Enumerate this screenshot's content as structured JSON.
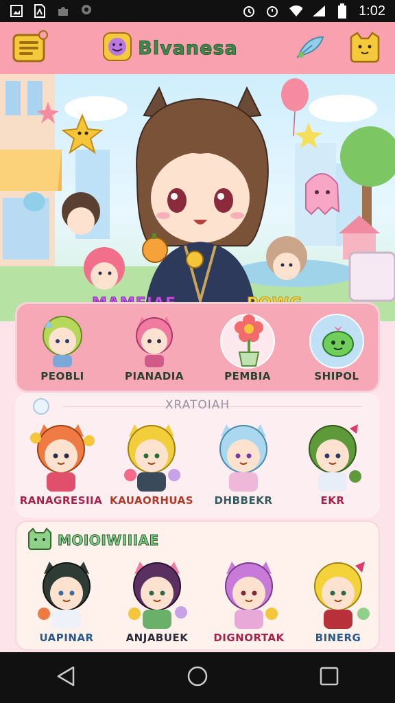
{
  "status_bar": {
    "time": "1:02",
    "icons": [
      "image-icon",
      "file-icon",
      "puzzle-icon",
      "location-icon",
      "alarm-icon",
      "alarm-icon",
      "wifi-icon",
      "signal-icon",
      "battery-icon"
    ]
  },
  "app_bar": {
    "title": "Blvanesa",
    "left_icon": "menu-icon",
    "right_icons": [
      "feather-icon",
      "cat-face-icon"
    ]
  },
  "hero": {
    "tag_left": "MAMEIAE",
    "tag_right": "POWG"
  },
  "featured": {
    "items": [
      {
        "label": "PEOBLI",
        "icon": "green-hair-chibi"
      },
      {
        "label": "PIANADIA",
        "icon": "pink-cat-chibi"
      },
      {
        "label": "PEMBIA",
        "icon": "flower-pot-icon"
      },
      {
        "label": "SHIPOL",
        "icon": "green-monster-icon"
      }
    ]
  },
  "section_two": {
    "title": "XRATOIAH",
    "characters": [
      {
        "label": "RANAGRESIIA",
        "hair": "#f07a43",
        "color": "#a8234b"
      },
      {
        "label": "KAUAORHUAS",
        "hair": "#f2cf3a",
        "color": "#b03a2a"
      },
      {
        "label": "DHBBEKR",
        "hair": "#a9d8f0",
        "color": "#355b5f"
      },
      {
        "label": "EKR",
        "hair": "#5f9a3a",
        "color": "#a8234b"
      }
    ]
  },
  "section_three": {
    "title": "MOIOIWIIIAE",
    "characters": [
      {
        "label": "UAPINAR",
        "hair": "#2f3c35",
        "color": "#2b5a8a"
      },
      {
        "label": "ANJABUEK",
        "hair": "#5a3060",
        "color": "#2b2b3a"
      },
      {
        "label": "DIGNORTAK",
        "hair": "#c77ad8",
        "color": "#a8234b"
      },
      {
        "label": "BINERG",
        "hair": "#f4d33a",
        "color": "#2b5a8a"
      }
    ]
  },
  "nav": {
    "icons": [
      "back-icon",
      "home-icon",
      "recents-icon"
    ]
  }
}
